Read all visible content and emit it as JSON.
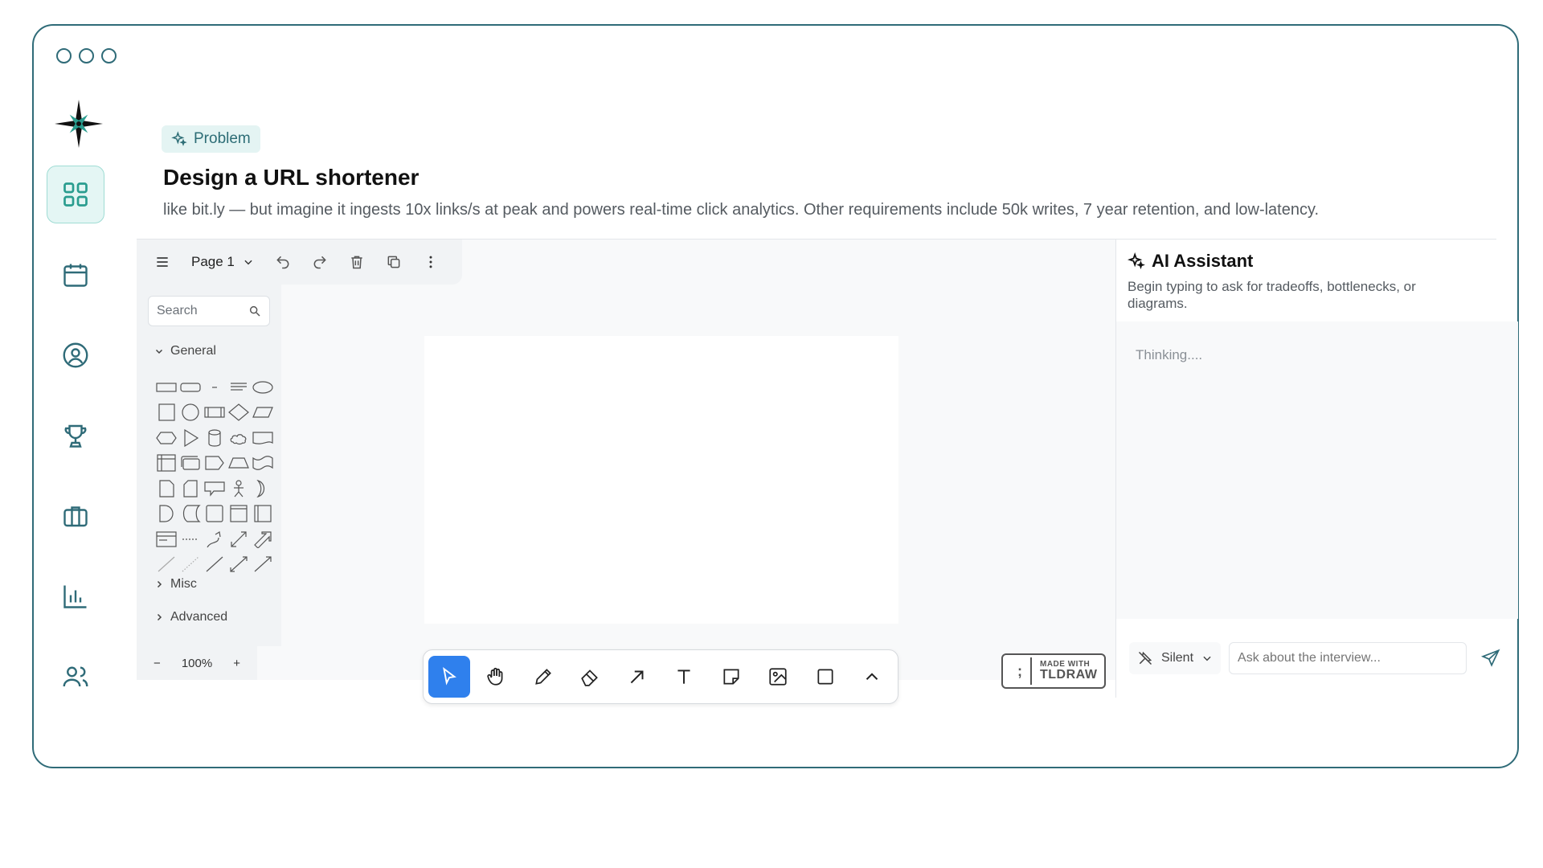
{
  "problem": {
    "badge": "Problem",
    "title": "Design a URL shortener",
    "description": "like bit.ly — but imagine it ingests 10x links/s at peak and powers real-time click analytics. Other requirements include 50k writes, 7 year retention, and low-latency."
  },
  "toolbar": {
    "page_label": "Page 1"
  },
  "shapes_panel": {
    "search_placeholder": "Search",
    "sections": {
      "general": "General",
      "misc": "Misc",
      "advanced": "Advanced"
    }
  },
  "zoom": {
    "minus": "−",
    "value": "100%",
    "plus": "+"
  },
  "tldraw_badge": {
    "line1": "MADE WITH",
    "line2": "TLDRAW"
  },
  "ai": {
    "title": "AI Assistant",
    "subtitle": "Begin typing to ask for tradeoffs, bottlenecks, or diagrams.",
    "thinking": "Thinking....",
    "mode": "Silent",
    "input_placeholder": "Ask about the interview..."
  },
  "colors": {
    "accent": "#2f6b78",
    "active_tool": "#2f80ed",
    "nav_active_bg": "#e4f6f4"
  }
}
